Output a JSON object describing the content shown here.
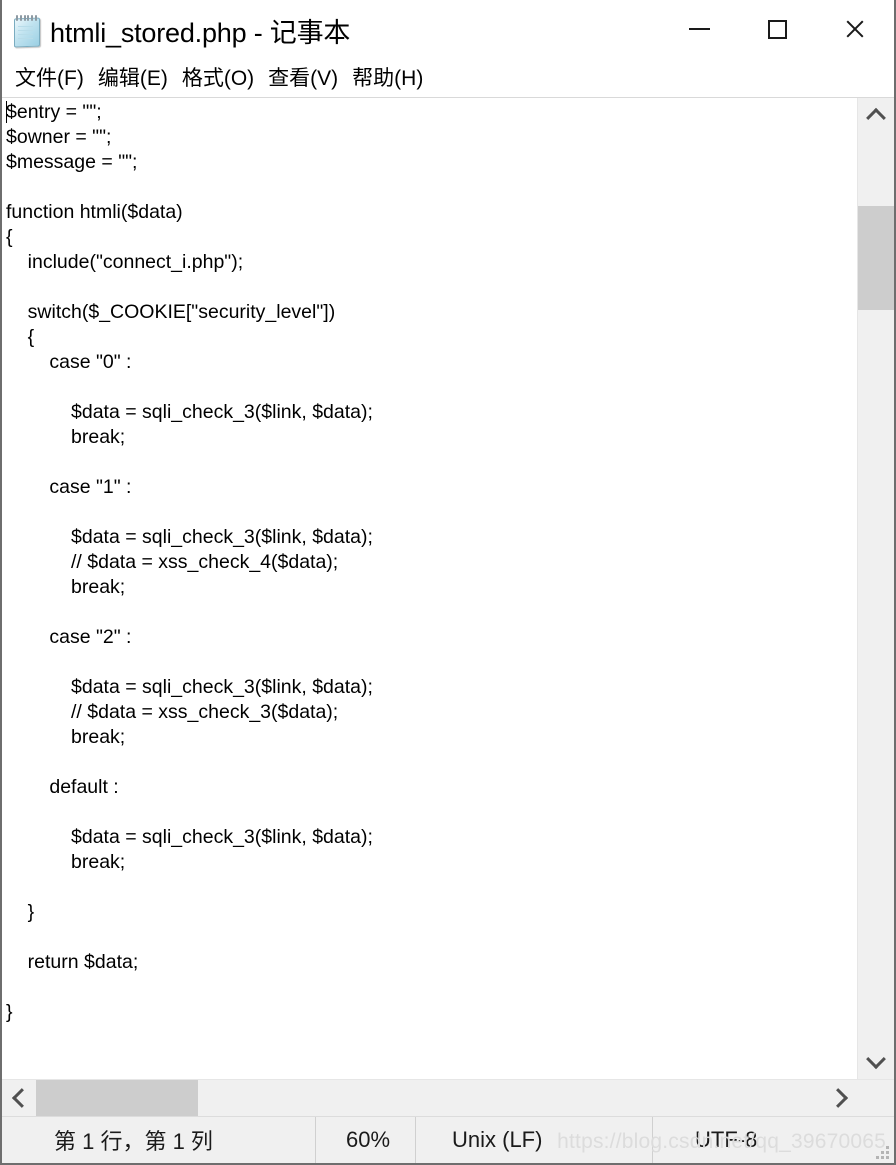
{
  "window": {
    "title": "htmli_stored.php - 记事本",
    "icon": "notepad-icon",
    "controls": {
      "minimize": "minimize-icon",
      "maximize": "maximize-icon",
      "close": "close-icon"
    }
  },
  "menubar": {
    "items": [
      {
        "label": "文件(F)"
      },
      {
        "label": "编辑(E)"
      },
      {
        "label": "格式(O)"
      },
      {
        "label": "查看(V)"
      },
      {
        "label": "帮助(H)"
      }
    ]
  },
  "editor": {
    "content": "$entry = \"\";\n$owner = \"\";\n$message = \"\";\n\nfunction htmli($data)\n{\n\tinclude(\"connect_i.php\");\n\n\tswitch($_COOKIE[\"security_level\"])\n\t{\n\t\tcase \"0\" :\n\n\t\t\t$data = sqli_check_3($link, $data);\n\t\t\tbreak;\n\n\t\tcase \"1\" :\n\n\t\t\t$data = sqli_check_3($link, $data);\n\t\t\t// $data = xss_check_4($data);\n\t\t\tbreak;\n\n\t\tcase \"2\" :\n\n\t\t\t$data = sqli_check_3($link, $data);\n\t\t\t// $data = xss_check_3($data);\n\t\t\tbreak;\n\n\t\tdefault :\n\n\t\t\t$data = sqli_check_3($link, $data);\n\t\t\tbreak;\n\n\t}\n\n\treturn $data;\n\n}"
  },
  "scrollbars": {
    "vertical": {
      "up_arrow": "chevron-up-icon",
      "down_arrow": "chevron-down-icon"
    },
    "horizontal": {
      "left_arrow": "chevron-left-icon",
      "right_arrow": "chevron-right-icon"
    }
  },
  "statusbar": {
    "position": "第 1 行，第 1 列",
    "zoom": "60%",
    "line_ending": "Unix (LF)",
    "encoding": "UTF-8"
  },
  "watermark": {
    "text": "https://blog.csdn.net/qq_39670065"
  }
}
